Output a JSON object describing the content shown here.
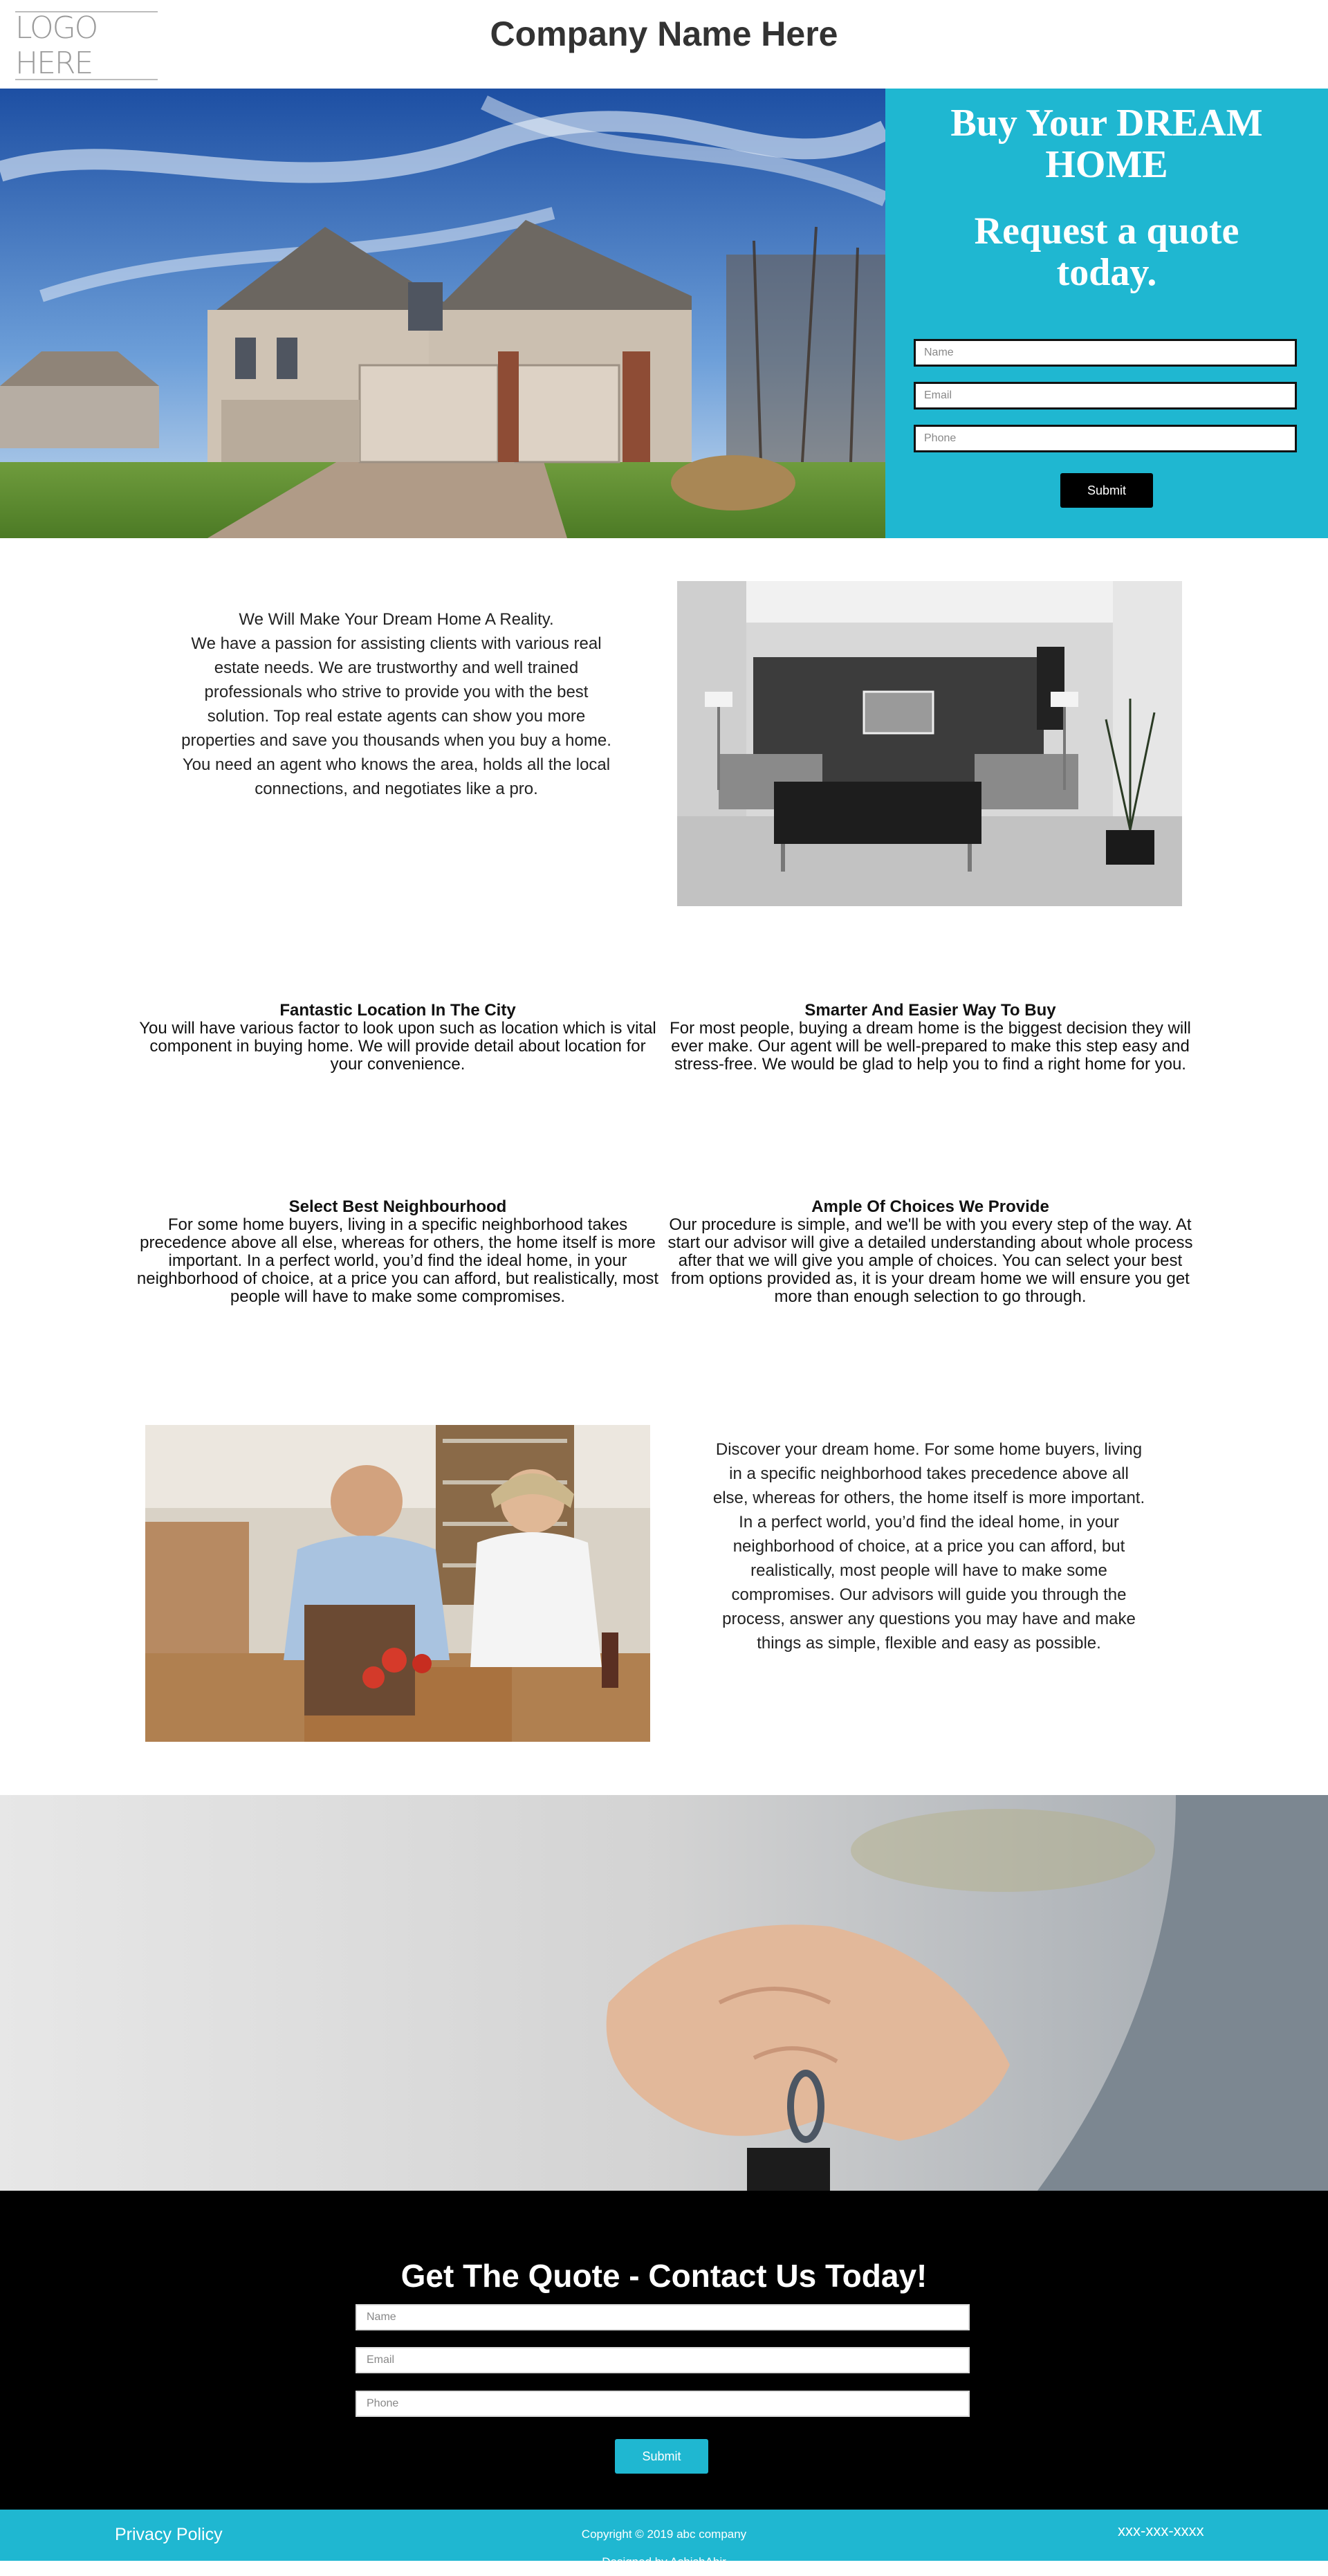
{
  "header": {
    "logo_text": "LOGO HERE",
    "company_name": "Company Name Here"
  },
  "hero": {
    "headline": "Buy Your DREAM HOME",
    "subheadline": "Request a quote today.",
    "form": {
      "name_placeholder": "Name",
      "email_placeholder": "Email",
      "phone_placeholder": "Phone",
      "submit_label": "Submit"
    }
  },
  "intro": {
    "title": "We Will Make Your Dream Home A Reality.",
    "body": "We have a passion for assisting clients with various real estate needs. We are trustworthy and well trained professionals who strive to provide you with the best solution. Top real estate agents can show you more properties and save you thousands when you buy a home. You need an agent who knows the area, holds all the local connections, and negotiates like a pro."
  },
  "features": [
    {
      "title": "Fantastic Location In The City",
      "body": "You will have various factor to look upon such as location which is vital component in buying home. We will provide detail about location for your convenience."
    },
    {
      "title": "Smarter And Easier Way To Buy",
      "body": "For most people, buying a dream home is the biggest decision they will ever make. Our agent will be well-prepared to make this step easy and stress-free. We would be glad to help you to find a right home for you."
    },
    {
      "title": "Select Best Neighbourhood",
      "body": "For some home buyers, living in a specific neighborhood takes precedence above all else, whereas for others, the home itself is more important. In a perfect world, you’d find the ideal home, in your neighborhood of choice, at a price you can afford, but realistically, most people will have to make some compromises."
    },
    {
      "title": "Ample Of Choices We Provide",
      "body": "Our procedure is simple, and we'll be with you every step of the way. At start our advisor will give a detailed understanding about whole process after that we will give you ample of choices. You can select your best from options provided as, it is your dream home we will ensure you get more than enough selection to go through."
    }
  ],
  "discover": {
    "body": "Discover your dream home. For some home buyers, living in a specific neighborhood takes precedence above all else, whereas for others, the home itself is more important. In a perfect world, you’d find the ideal home, in your neighborhood of choice, at a price you can afford, but realistically, most people will have to make some compromises. Our advisors will guide you through the process, answer any questions you may have and make things as simple, flexible and easy as possible."
  },
  "contact": {
    "title": "Get The Quote - Contact Us Today!",
    "name_placeholder": "Name",
    "email_placeholder": "Email",
    "phone_placeholder": "Phone",
    "submit_label": "Submit"
  },
  "footer": {
    "privacy_label": "Privacy Policy",
    "copyright": "Copyright © 2019 abc company",
    "designed_by": "Designed by AshishAhir",
    "phone": "xxx-xxx-xxxx"
  },
  "colors": {
    "accent": "#1fb7d1",
    "dark": "#000000",
    "header_text": "#333333"
  }
}
